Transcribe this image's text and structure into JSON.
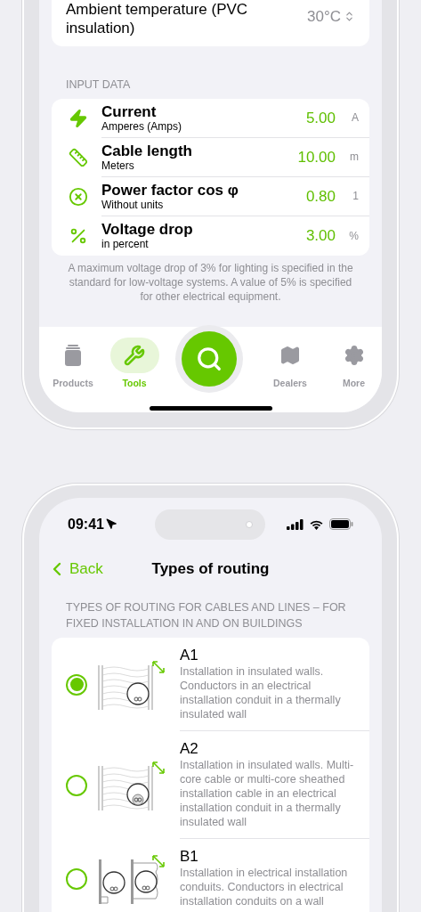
{
  "screen_1": {
    "ambient_row": {
      "label": "Ambient temperature (PVC insulation)",
      "value": "30°C"
    },
    "input_section_title": "INPUT DATA",
    "inputs": [
      {
        "kind": "bolt",
        "title": "Current",
        "subtitle": "Amperes (Amps)",
        "value": "5.00",
        "unit": "A"
      },
      {
        "kind": "ruler",
        "title": "Cable length",
        "subtitle": "Meters",
        "value": "10.00",
        "unit": "m"
      },
      {
        "kind": "circle_x",
        "title": "Power factor cos φ",
        "subtitle": "Without units",
        "value": "0.80",
        "unit": "1"
      },
      {
        "kind": "percent",
        "title": "Voltage drop",
        "subtitle": "in percent",
        "value": "3.00",
        "unit": "%"
      }
    ],
    "footnote": "A maximum voltage drop of 3% for lighting is specified in the standard for low-voltage systems. A value of 5% is specified for other electrical equipment.",
    "tab_bar": [
      {
        "kind": "products",
        "label": "Products",
        "selected": false
      },
      {
        "kind": "tools",
        "label": "Tools",
        "selected": true
      },
      {
        "kind": "search",
        "selected": false
      },
      {
        "kind": "dealers",
        "label": "Dealers",
        "selected": false
      },
      {
        "kind": "more",
        "label": "More",
        "selected": false
      }
    ]
  },
  "screen_2": {
    "status_bar": {
      "time": "09:41"
    },
    "nav": {
      "back": "Back",
      "title": "Types of routing"
    },
    "section_title": "TYPES OF ROUTING FOR CABLES AND LINES – FOR FIXED INSTALLATION IN AND ON BUILDINGS",
    "routing_types": [
      {
        "kind": "insulated_wall_conductors",
        "code": "A1",
        "description": "Installation in insulated walls. Conductors in an electrical installation conduit in a thermally insulated wall",
        "selected": true
      },
      {
        "kind": "insulated_wall_cable",
        "code": "A2",
        "description": "Installation in insulated walls. Multi-core cable or multi-core sheathed installation cable in an electrical installation conduit in a thermally insulated wall",
        "selected": false
      },
      {
        "kind": "conduit_on_wall",
        "code": "B1",
        "description": "Installation in electrical installation conduits. Conductors in electrical installation conduits on a wall",
        "selected": false
      }
    ]
  }
}
